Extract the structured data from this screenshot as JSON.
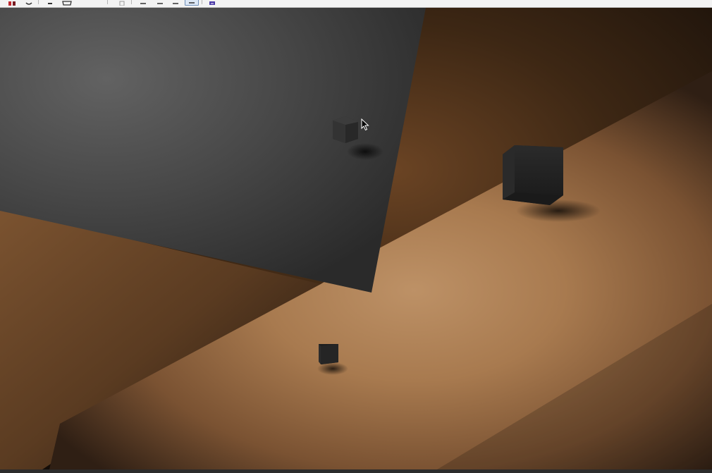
{
  "toolbar": {
    "buttons": [
      {
        "name": "red-app-icon"
      },
      {
        "name": "undo-icon"
      },
      {
        "name": "pin-icon"
      },
      {
        "name": "folder-image-icon"
      },
      {
        "name": "copy-icon"
      },
      {
        "name": "zoom-in-icon"
      },
      {
        "name": "zoom-out-icon"
      },
      {
        "name": "fit-window-icon"
      },
      {
        "name": "select-region-icon"
      },
      {
        "name": "fullscreen-icon"
      }
    ],
    "active_tool": "select-region-icon"
  },
  "scene": {
    "kind": "3D render: dark tilted panel over warm brown ground with three dark cubes",
    "colors": {
      "panel_light": "#5c5c5c",
      "panel_dark": "#2f2f2f",
      "ground_light": "#b98c5e",
      "ground_mid": "#8e6138",
      "ground_dark": "#2a1c12",
      "back_wall": "#3a2717",
      "cube": "#2a2a2a"
    }
  },
  "cursor": {
    "icon": "arrow-cursor-icon"
  }
}
